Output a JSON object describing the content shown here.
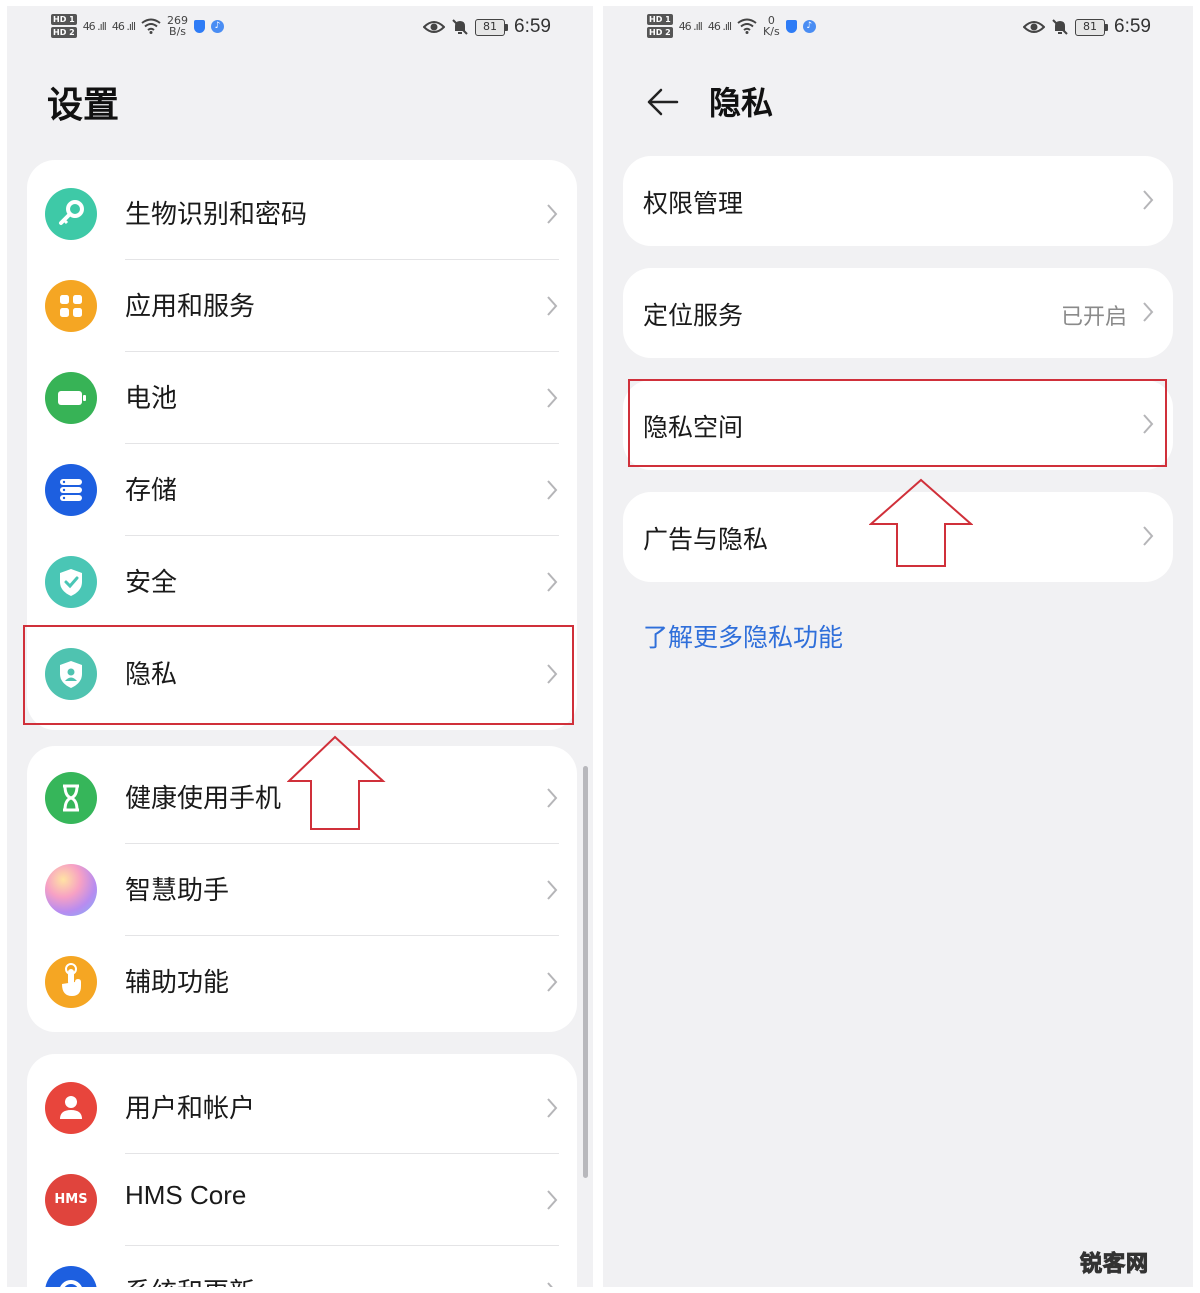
{
  "left": {
    "status": {
      "hd1": "HD 1",
      "hd2": "HD 2",
      "sig1": "46 .ıll",
      "sig2": "46 .ıll",
      "rate_value": "269",
      "rate_unit": "B/s",
      "battery": "81",
      "time": "6:59"
    },
    "title": "设置",
    "groups": [
      {
        "items": [
          {
            "label": "生物识别和密码",
            "icon": "key-icon",
            "color": "#3ec9a7"
          },
          {
            "label": "应用和服务",
            "icon": "apps-grid-icon",
            "color": "#f5a623"
          },
          {
            "label": "电池",
            "icon": "battery-icon",
            "color": "#37b356"
          },
          {
            "label": "存储",
            "icon": "storage-icon",
            "color": "#1d5fe0"
          },
          {
            "label": "安全",
            "icon": "shield-check-icon",
            "color": "#4ac6b5"
          },
          {
            "label": "隐私",
            "icon": "privacy-shield-icon",
            "color": "#4fc3b0"
          }
        ]
      },
      {
        "items": [
          {
            "label": "健康使用手机",
            "icon": "hourglass-icon",
            "color": "#36b65a"
          },
          {
            "label": "智慧助手",
            "icon": "assistant-orb-icon",
            "color": "#b88cf0"
          },
          {
            "label": "辅助功能",
            "icon": "hand-pointer-icon",
            "color": "#f5a623"
          }
        ]
      },
      {
        "items": [
          {
            "label": "用户和帐户",
            "icon": "user-icon",
            "color": "#e8453c"
          },
          {
            "label": "HMS Core",
            "icon": "hms-icon",
            "icon_text": "HMS",
            "color": "#e0443d"
          },
          {
            "label": "系统和更新",
            "icon": "system-gear-icon",
            "color": "#1d5fe0"
          }
        ]
      }
    ]
  },
  "right": {
    "status": {
      "hd1": "HD 1",
      "hd2": "HD 2",
      "sig1": "46 .ıll",
      "sig2": "46 .ıll",
      "rate_value": "0",
      "rate_unit": "K/s",
      "battery": "81",
      "time": "6:59"
    },
    "title": "隐私",
    "rows": [
      {
        "label": "权限管理",
        "value": ""
      },
      {
        "label": "定位服务",
        "value": "已开启"
      },
      {
        "label": "隐私空间",
        "value": ""
      },
      {
        "label": "广告与隐私",
        "value": ""
      }
    ],
    "link": "了解更多隐私功能"
  },
  "watermark": {
    "part1": "锐客",
    "part2": "网"
  },
  "colors": {
    "highlight": "#d0303a",
    "link": "#2f6fda",
    "background": "#f1f1f3"
  }
}
